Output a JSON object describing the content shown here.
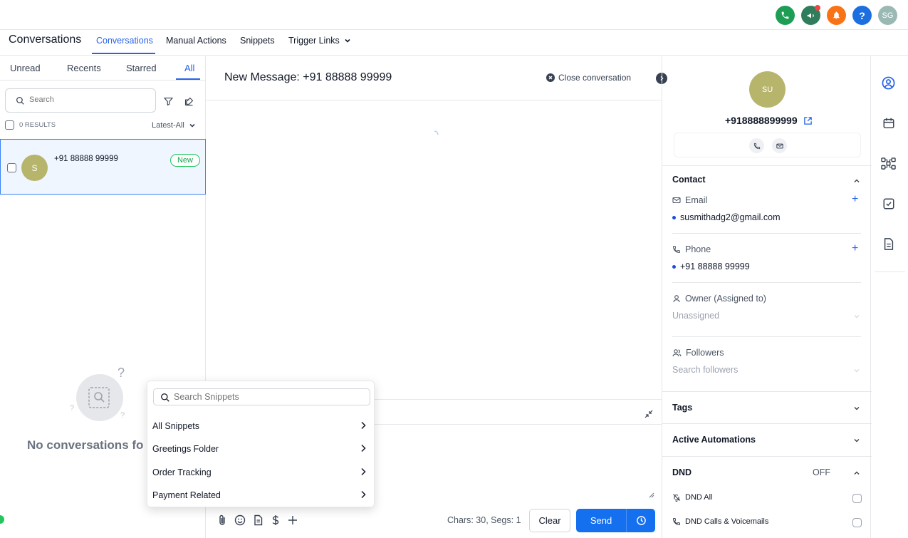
{
  "topbar": {
    "user_initials": "SG",
    "help_glyph": "?",
    "icons": [
      "phone-icon",
      "megaphone-icon",
      "bell-icon",
      "help-icon"
    ],
    "colors": {
      "phone": "#1e9e55",
      "megaphone": "#2f7d5a",
      "bell": "#f97316",
      "help": "#1d6fe0",
      "avatar": "#9ab9b5"
    }
  },
  "nav": {
    "title": "Conversations",
    "tabs": [
      {
        "label": "Conversations",
        "active": true
      },
      {
        "label": "Manual Actions"
      },
      {
        "label": "Snippets"
      },
      {
        "label": "Trigger Links"
      }
    ]
  },
  "left": {
    "tabs": [
      "Unread",
      "Recents",
      "Starred",
      "All"
    ],
    "active_tab": "All",
    "search_placeholder": "Search",
    "results_label": "0 RESULTS",
    "sort_label": "Latest-All",
    "conversation": {
      "avatar": "S",
      "name": "+91 88888 99999",
      "badge": "New"
    },
    "empty_text": "No conversations fo",
    "empty_glyph": "?"
  },
  "middle": {
    "title": "New Message: +91 88888 99999",
    "close_label": "Close conversation",
    "chars_label": "Chars: 30, Segs: 1",
    "clear_label": "Clear",
    "send_label": "Send"
  },
  "snippets": {
    "search_placeholder": "Search Snippets",
    "items": [
      "All Snippets",
      "Greetings Folder",
      "Order Tracking",
      "Payment Related"
    ]
  },
  "right": {
    "avatar": "SU",
    "phone_title": "+918888899999",
    "contact_title": "Contact",
    "email_label": "Email",
    "email_value": "susmithadg2@gmail.com",
    "phone_label": "Phone",
    "phone_value": "+91 88888 99999",
    "owner_label": "Owner (Assigned to)",
    "owner_value": "Unassigned",
    "followers_label": "Followers",
    "followers_placeholder": "Search followers",
    "tags_title": "Tags",
    "automations_title": "Active Automations",
    "dnd_title": "DND",
    "dnd_status": "OFF",
    "dnd_all": "DND All",
    "dnd_calls": "DND Calls & Voicemails",
    "plus_glyph": "+"
  }
}
